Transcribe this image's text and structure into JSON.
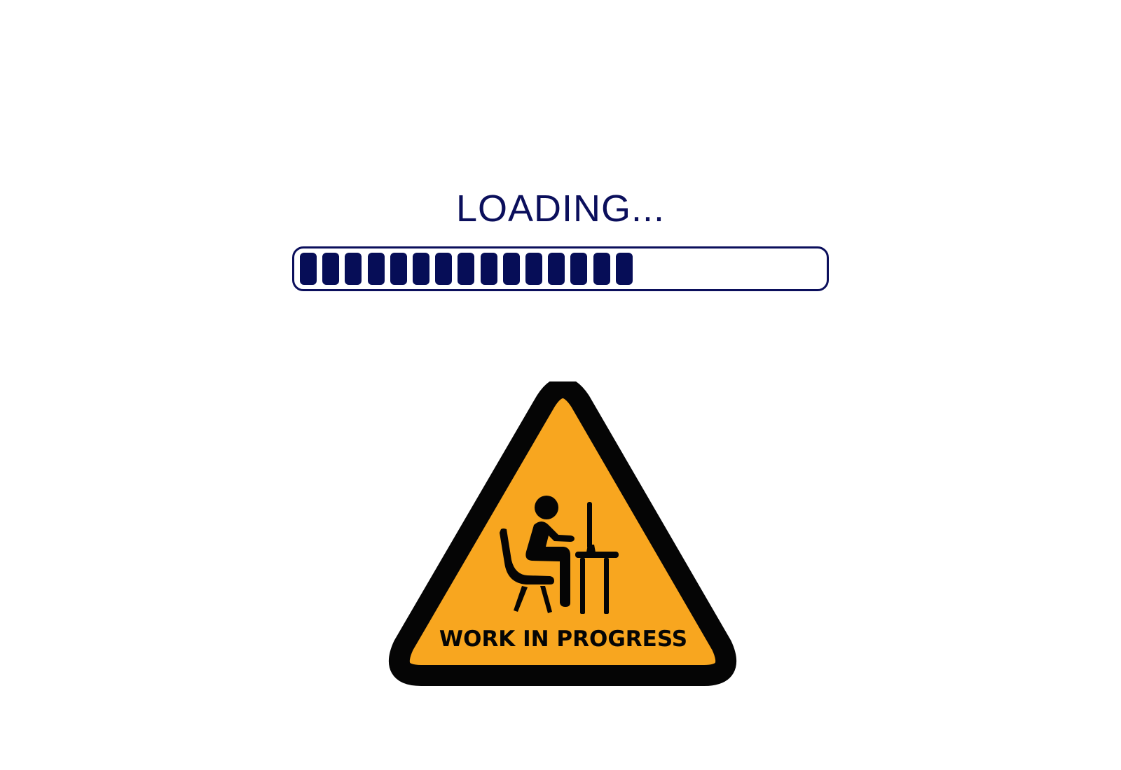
{
  "loading": {
    "label": "LOADING...",
    "progress_fraction": 0.6,
    "filled_segments": 15,
    "colors": {
      "bar_outline": "#0b0f5c",
      "segment_fill": "#060d57"
    }
  },
  "sign": {
    "caption": "WORK IN PROGRESS",
    "icon": "person-at-computer-desk-icon",
    "colors": {
      "background": "#f8a61f",
      "border": "#050505",
      "figure": "#050505"
    }
  }
}
